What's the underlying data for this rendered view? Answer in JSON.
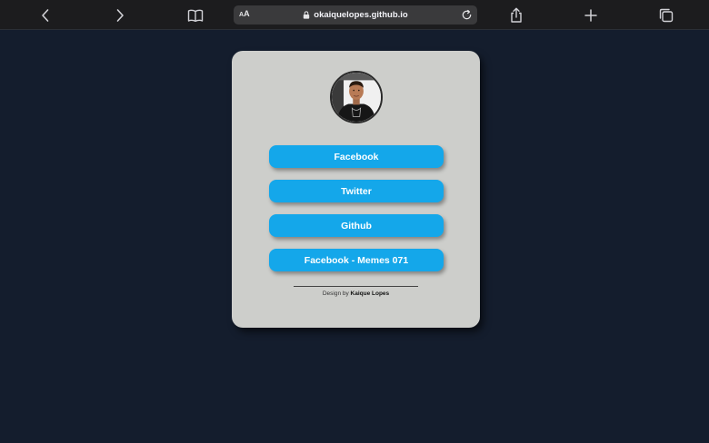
{
  "browser": {
    "text_size_label_small": "A",
    "text_size_label_large": "A",
    "url": "okaiquelopes.github.io",
    "icons": [
      "chevron-left-icon",
      "chevron-right-icon",
      "book-icon",
      "lock-icon",
      "reload-icon",
      "share-icon",
      "plus-icon",
      "tabs-icon"
    ]
  },
  "profile": {
    "avatar": "avatar-photo"
  },
  "links": [
    {
      "label": "Facebook"
    },
    {
      "label": "Twitter"
    },
    {
      "label": "Github"
    },
    {
      "label": "Facebook - Memes 071"
    }
  ],
  "footer": {
    "prefix": "Design by",
    "author": "Kaique Lopes"
  },
  "colors": {
    "page_background": "#141d2d",
    "card_background": "#cdcecb",
    "button_background": "#14a7ea",
    "button_text": "#ffffff"
  }
}
